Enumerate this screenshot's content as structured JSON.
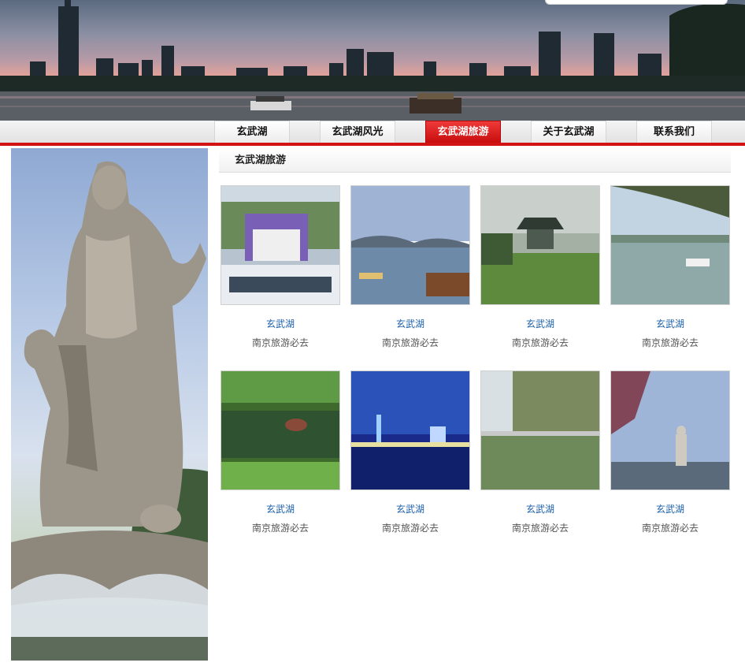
{
  "nav": {
    "items": [
      {
        "label": "玄武湖",
        "active": false
      },
      {
        "label": "玄武湖风光",
        "active": false
      },
      {
        "label": "玄武湖旅游",
        "active": true
      },
      {
        "label": "关于玄武湖",
        "active": false
      },
      {
        "label": "联系我们",
        "active": false
      }
    ]
  },
  "main": {
    "section_title": "玄武湖旅游",
    "cards": [
      {
        "title": "玄武湖",
        "subtitle": "南京旅游必去"
      },
      {
        "title": "玄武湖",
        "subtitle": "南京旅游必去"
      },
      {
        "title": "玄武湖",
        "subtitle": "南京旅游必去"
      },
      {
        "title": "玄武湖",
        "subtitle": "南京旅游必去"
      },
      {
        "title": "玄武湖",
        "subtitle": "南京旅游必去"
      },
      {
        "title": "玄武湖",
        "subtitle": "南京旅游必去"
      },
      {
        "title": "玄武湖",
        "subtitle": "南京旅游必去"
      },
      {
        "title": "玄武湖",
        "subtitle": "南京旅游必去"
      }
    ]
  },
  "colors": {
    "accent_red": "#d21313",
    "link_blue": "#1b5fa8",
    "subtitle_gray": "#555555"
  }
}
